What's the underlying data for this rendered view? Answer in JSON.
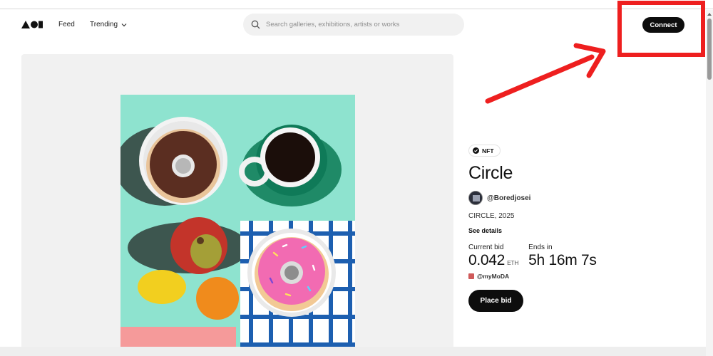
{
  "header": {
    "nav": {
      "feed": "Feed",
      "trending": "Trending"
    },
    "search": {
      "placeholder": "Search galleries, exhibitions, artists or works"
    },
    "connect_label": "Connect"
  },
  "artwork": {
    "badge": "NFT",
    "title": "Circle",
    "artist": "@Boredjosei",
    "collection": "CIRCLE, 2025",
    "see_details": "See details",
    "current_bid_label": "Current bid",
    "current_bid_value": "0.042",
    "current_bid_unit": "ETH",
    "ends_in_label": "Ends in",
    "ends_in_value": "5h 16m 7s",
    "bidder": "@myMoDA",
    "place_bid_label": "Place bid"
  },
  "colors": {
    "accent_black": "#0d0d0d",
    "annotation_red": "#ee1f1f",
    "art_background": "#8ee3cf"
  },
  "icons": [
    "logo-icon",
    "chevron-down-icon",
    "search-icon",
    "verified-check-icon",
    "annotation-arrow"
  ]
}
